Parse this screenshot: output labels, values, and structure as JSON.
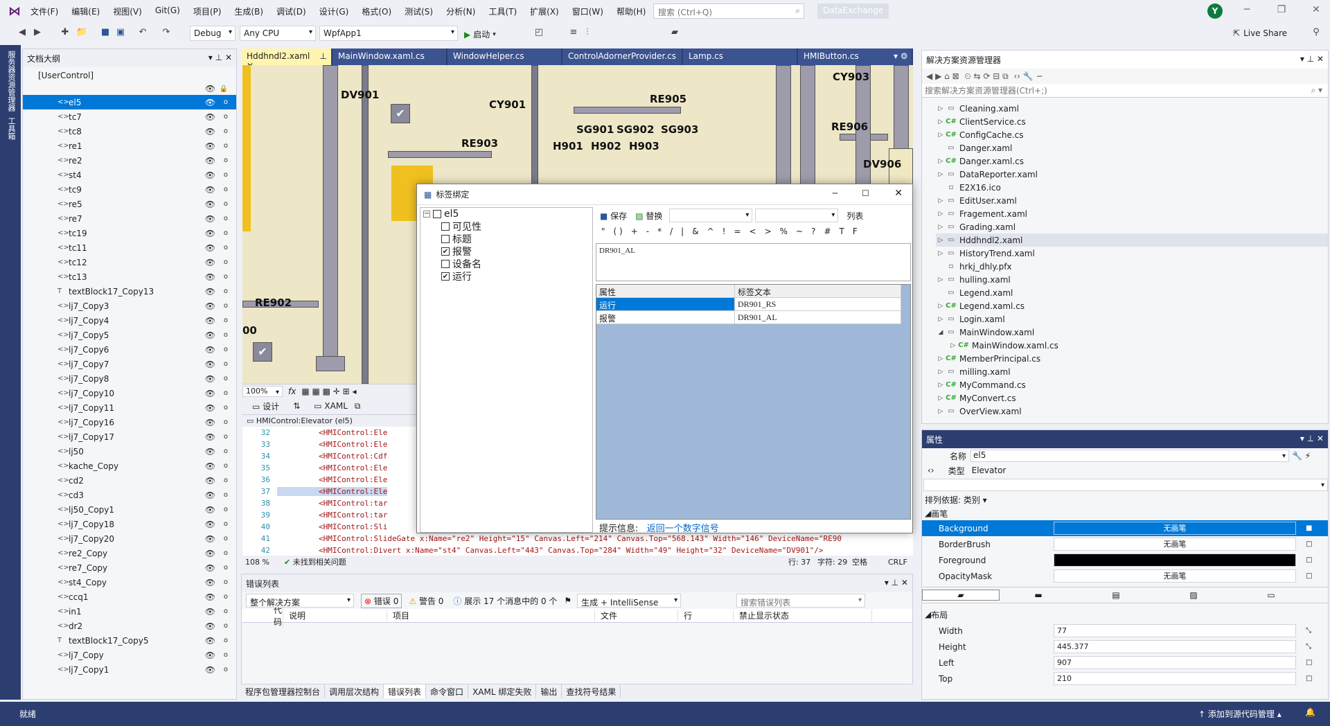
{
  "menubar": {
    "items": [
      "文件(F)",
      "编辑(E)",
      "视图(V)",
      "Git(G)",
      "项目(P)",
      "生成(B)",
      "调试(D)",
      "设计(G)",
      "格式(O)",
      "测试(S)",
      "分析(N)",
      "工具(T)",
      "扩展(X)",
      "窗口(W)",
      "帮助(H)"
    ],
    "search_placeholder": "搜索 (Ctrl+Q)",
    "solution_name": "DataExchange",
    "avatar": "Y"
  },
  "toolbar": {
    "config": "Debug",
    "platform": "Any CPU",
    "project": "WpfApp1",
    "start": "启动",
    "live_share": "Live Share"
  },
  "leftstrip": {
    "items": [
      "服务器资源管理器",
      "工具箱"
    ]
  },
  "outline": {
    "title": "文档大纲",
    "root": "[UserControl]",
    "items": [
      {
        "tag": "<>",
        "name": "el5",
        "sel": true
      },
      {
        "tag": "<>",
        "name": "tc7"
      },
      {
        "tag": "<>",
        "name": "tc8"
      },
      {
        "tag": "<>",
        "name": "re1"
      },
      {
        "tag": "<>",
        "name": "re2"
      },
      {
        "tag": "<>",
        "name": "st4"
      },
      {
        "tag": "<>",
        "name": "tc9"
      },
      {
        "tag": "<>",
        "name": "re5"
      },
      {
        "tag": "<>",
        "name": "re7"
      },
      {
        "tag": "<>",
        "name": "tc19"
      },
      {
        "tag": "<>",
        "name": "tc11"
      },
      {
        "tag": "<>",
        "name": "tc12"
      },
      {
        "tag": "<>",
        "name": "tc13"
      },
      {
        "tag": "T",
        "name": "textBlock17_Copy13"
      },
      {
        "tag": "<>",
        "name": "lj7_Copy3"
      },
      {
        "tag": "<>",
        "name": "lj7_Copy4"
      },
      {
        "tag": "<>",
        "name": "lj7_Copy5"
      },
      {
        "tag": "<>",
        "name": "lj7_Copy6"
      },
      {
        "tag": "<>",
        "name": "lj7_Copy7"
      },
      {
        "tag": "<>",
        "name": "lj7_Copy8"
      },
      {
        "tag": "<>",
        "name": "lj7_Copy10"
      },
      {
        "tag": "<>",
        "name": "lj7_Copy11"
      },
      {
        "tag": "<>",
        "name": "lj7_Copy16"
      },
      {
        "tag": "<>",
        "name": "lj7_Copy17"
      },
      {
        "tag": "<>",
        "name": "lj50"
      },
      {
        "tag": "<>",
        "name": "kache_Copy"
      },
      {
        "tag": "<>",
        "name": "cd2"
      },
      {
        "tag": "<>",
        "name": "cd3"
      },
      {
        "tag": "<>",
        "name": "lj50_Copy1"
      },
      {
        "tag": "<>",
        "name": "lj7_Copy18"
      },
      {
        "tag": "<>",
        "name": "lj7_Copy20"
      },
      {
        "tag": "<>",
        "name": "re2_Copy"
      },
      {
        "tag": "<>",
        "name": "re7_Copy"
      },
      {
        "tag": "<>",
        "name": "st4_Copy"
      },
      {
        "tag": "<>",
        "name": "ccq1"
      },
      {
        "tag": "<>",
        "name": "in1"
      },
      {
        "tag": "<>",
        "name": "dr2"
      },
      {
        "tag": "T",
        "name": "textBlock17_Copy5"
      },
      {
        "tag": "<>",
        "name": "lj7_Copy"
      },
      {
        "tag": "<>",
        "name": "lj7_Copy1"
      }
    ]
  },
  "doc_tabs": [
    "Hddhndl2.xaml",
    "MainWindow.xaml.cs",
    "WindowHelper.cs",
    "ControlAdornerProvider.cs",
    "Lamp.cs",
    "HMIButton.cs"
  ],
  "canvas_labels": [
    "DV901",
    "CY901",
    "RE905",
    "CY903",
    "SG901",
    "SG902",
    "SG903",
    "RE906",
    "H901",
    "H902",
    "H903",
    "RE903",
    "DV906",
    "RE902",
    "00"
  ],
  "designer": {
    "zoom": "100%",
    "design_tab": "设计",
    "xaml_tab": "XAML",
    "crumb": "HMIControl:Elevator (el5)"
  },
  "code": {
    "lines": [
      {
        "n": "32",
        "t": "<HMIControl:Ele"
      },
      {
        "n": "33",
        "t": "<HMIControl:Ele"
      },
      {
        "n": "34",
        "t": "<HMIControl:Cdf"
      },
      {
        "n": "35",
        "t": "<HMIControl:Ele"
      },
      {
        "n": "36",
        "t": "<HMIControl:Ele"
      },
      {
        "n": "37",
        "t": "<HMIControl:Ele",
        "hl": true
      },
      {
        "n": "38",
        "t": "<HMIControl:tar"
      },
      {
        "n": "39",
        "t": "<HMIControl:tar"
      },
      {
        "n": "40",
        "t": "<HMIControl:Sli"
      },
      {
        "n": "41",
        "t": "<HMIControl:SlideGate x:Name=\"re2\" Height=\"15\" Canvas.Left=\"214\" Canvas.Top=\"568.143\" Width=\"146\" DeviceName=\"RE90"
      },
      {
        "n": "42",
        "t": "<HMIControl:Divert x:Name=\"st4\" Canvas.Left=\"443\" Canvas.Top=\"284\" Width=\"49\" Height=\"32\" DeviceName=\"DV901\"/>"
      }
    ],
    "zoom": "108 %",
    "issues": "未找到相关问题",
    "line": "行: 37",
    "char": "字符: 29",
    "ws": "空格",
    "eol": "CRLF"
  },
  "errorlist": {
    "title": "错误列表",
    "scope": "整个解决方案",
    "errors": "错误 0",
    "warnings": "警告 0",
    "messages": "展示 17 个消息中的 0 个",
    "build": "生成 + IntelliSense",
    "search": "搜索错误列表",
    "cols": [
      "代码",
      "说明",
      "项目",
      "文件",
      "行",
      "禁止显示状态"
    ]
  },
  "bottom_tabs": [
    "程序包管理器控制台",
    "调用层次结构",
    "错误列表",
    "命令窗口",
    "XAML 绑定失败",
    "输出",
    "查找符号结果"
  ],
  "solexp": {
    "title": "解决方案资源管理器",
    "search": "搜索解决方案资源管理器(Ctrl+;)",
    "items": [
      {
        "name": "Cleaning.xaml",
        "a": true,
        "i": "▭"
      },
      {
        "name": "ClientService.cs",
        "a": true,
        "i": "C#"
      },
      {
        "name": "ConfigCache.cs",
        "a": true,
        "i": "C#"
      },
      {
        "name": "Danger.xaml",
        "a": false,
        "i": "▭"
      },
      {
        "name": "Danger.xaml.cs",
        "a": true,
        "i": "C#"
      },
      {
        "name": "DataReporter.xaml",
        "a": true,
        "i": "▭"
      },
      {
        "name": "E2X16.ico",
        "a": false,
        "i": "▫"
      },
      {
        "name": "EditUser.xaml",
        "a": true,
        "i": "▭"
      },
      {
        "name": "Fragement.xaml",
        "a": true,
        "i": "▭"
      },
      {
        "name": "Grading.xaml",
        "a": true,
        "i": "▭"
      },
      {
        "name": "Hddhndl2.xaml",
        "a": true,
        "i": "▭",
        "sel": true
      },
      {
        "name": "HistoryTrend.xaml",
        "a": true,
        "i": "▭"
      },
      {
        "name": "hrkj_dhly.pfx",
        "a": false,
        "i": "▫"
      },
      {
        "name": "hulling.xaml",
        "a": true,
        "i": "▭"
      },
      {
        "name": "Legend.xaml",
        "a": false,
        "i": "▭"
      },
      {
        "name": "Legend.xaml.cs",
        "a": true,
        "i": "C#"
      },
      {
        "name": "Login.xaml",
        "a": true,
        "i": "▭"
      },
      {
        "name": "MainWindow.xaml",
        "a": true,
        "i": "▭",
        "open": true
      },
      {
        "name": "MainWindow.xaml.cs",
        "a": true,
        "i": "C#",
        "sub": true
      },
      {
        "name": "MemberPrincipal.cs",
        "a": true,
        "i": "C#"
      },
      {
        "name": "milling.xaml",
        "a": true,
        "i": "▭"
      },
      {
        "name": "MyCommand.cs",
        "a": true,
        "i": "C#"
      },
      {
        "name": "MyConvert.cs",
        "a": true,
        "i": "C#"
      },
      {
        "name": "OverView.xaml",
        "a": true,
        "i": "▭"
      }
    ]
  },
  "props": {
    "title": "属性",
    "name_label": "名称",
    "name_value": "el5",
    "type_label": "类型",
    "type_value": "Elevator",
    "sort": "排列依据: 类别 ▾",
    "brush_cat": "画笔",
    "brushes": [
      {
        "n": "Background",
        "v": "无画笔",
        "sel": true
      },
      {
        "n": "BorderBrush",
        "v": "无画笔"
      },
      {
        "n": "Foreground",
        "v": ""
      },
      {
        "n": "OpacityMask",
        "v": "无画笔"
      }
    ],
    "layout_cat": "布局",
    "layout": [
      {
        "n": "Width",
        "v": "77"
      },
      {
        "n": "Height",
        "v": "445.377"
      },
      {
        "n": "Left",
        "v": "907"
      },
      {
        "n": "Top",
        "v": "210"
      }
    ]
  },
  "status": {
    "left": "就绪",
    "right": "添加到源代码管理 ▴"
  },
  "dialog": {
    "title": "标签绑定",
    "root": "el5",
    "nodes": [
      {
        "l": "可见性",
        "c": false
      },
      {
        "l": "标题",
        "c": false
      },
      {
        "l": "报警",
        "c": true
      },
      {
        "l": "设备名",
        "c": false
      },
      {
        "l": "运行",
        "c": true
      }
    ],
    "save": "保存",
    "replace": "替换",
    "list": "列表",
    "ops": [
      "\"",
      "( )",
      "+",
      "-",
      "*",
      "/",
      "|",
      "&",
      "^",
      "!",
      "=",
      "<",
      ">",
      "%",
      "~",
      "?",
      "#",
      "T",
      "F"
    ],
    "formula": "DR901_AL",
    "grid_headers": [
      "属性",
      "标签文本"
    ],
    "grid_rows": [
      {
        "p": "运行",
        "v": "DR901_RS",
        "sel": true
      },
      {
        "p": "报警",
        "v": "DR901_AL"
      }
    ],
    "hint_label": "提示信息:",
    "hint_value": "返回一个数字信号"
  }
}
